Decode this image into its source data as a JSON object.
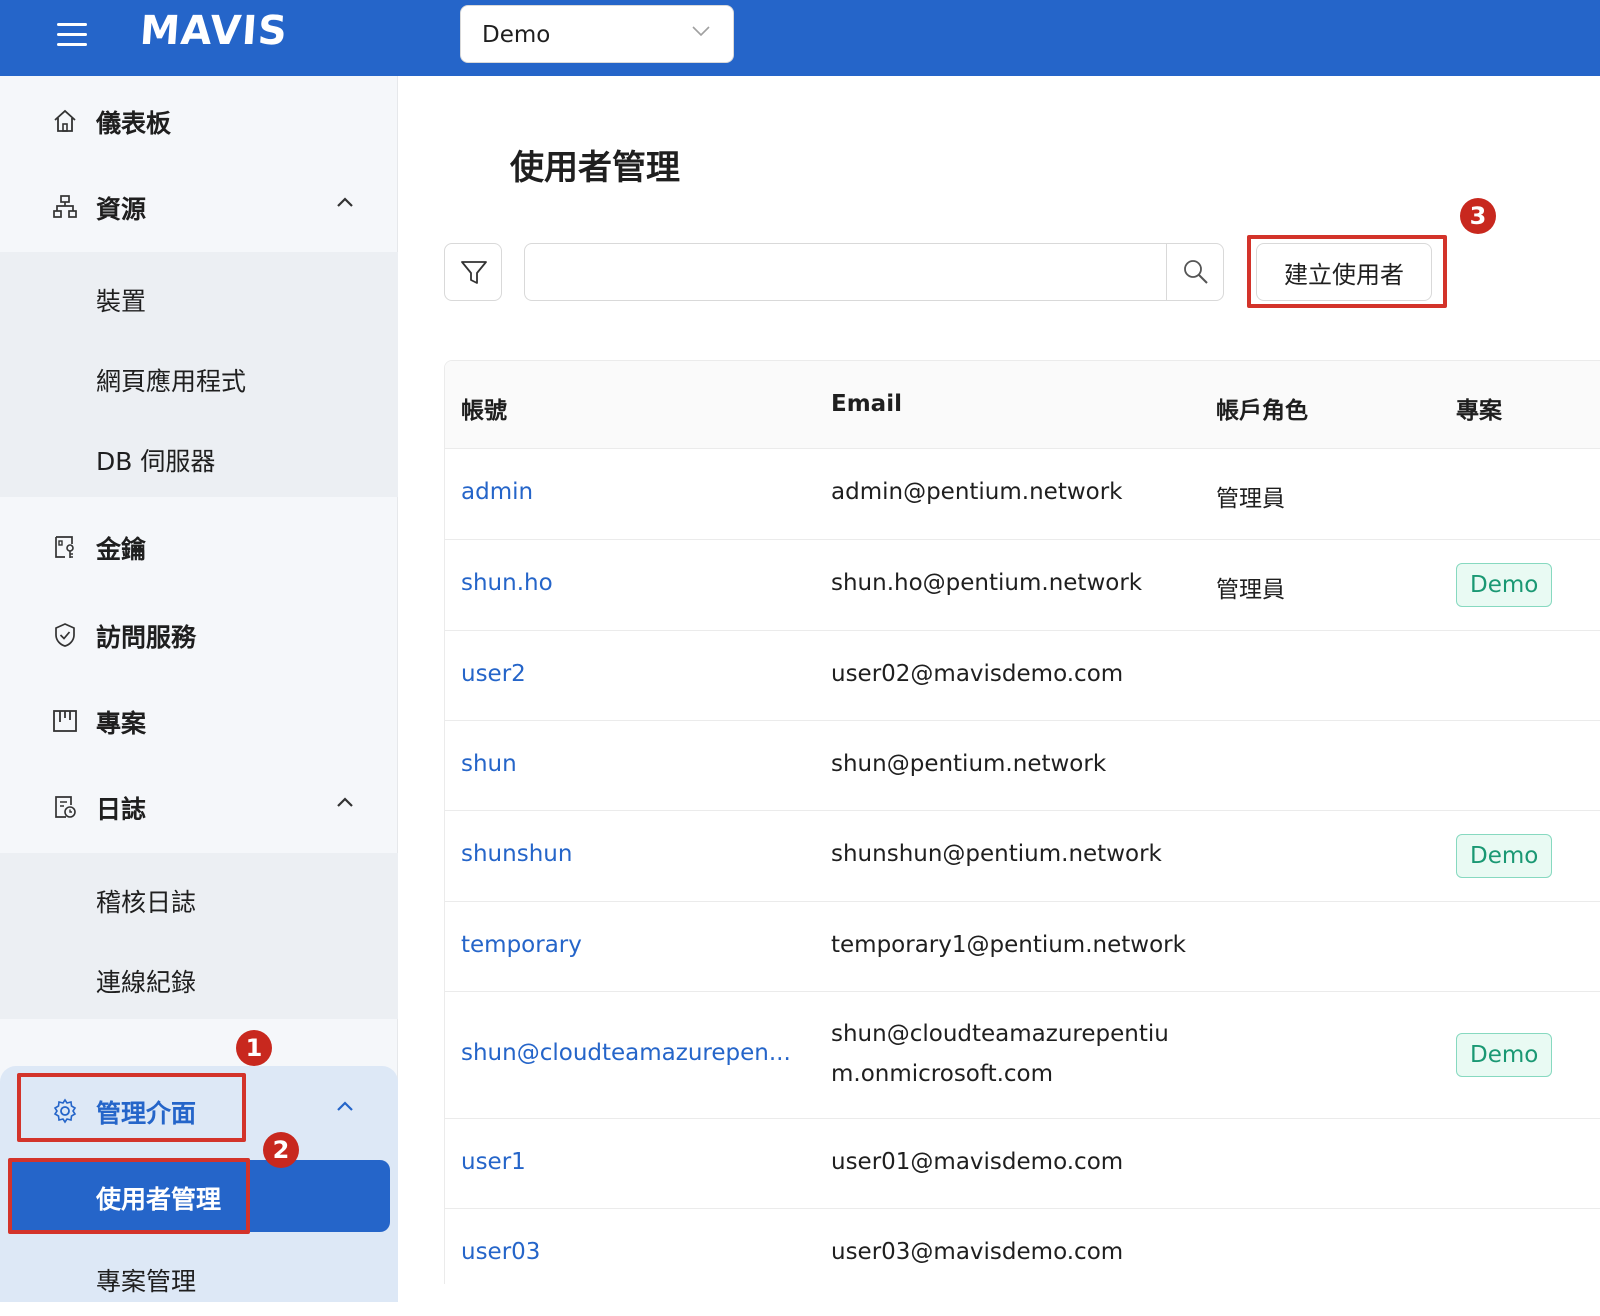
{
  "header": {
    "logo": "MAVIS",
    "project_select": "Demo"
  },
  "sidebar": {
    "dashboard": "儀表板",
    "resources": "資源",
    "resources_sub": [
      "裝置",
      "網頁應用程式",
      "DB 伺服器"
    ],
    "keys": "金鑰",
    "access_service": "訪問服務",
    "projects": "專案",
    "logs": "日誌",
    "logs_sub": [
      "稽核日誌",
      "連線紀錄"
    ],
    "admin": "管理介面",
    "admin_sub_active": "使用者管理",
    "admin_sub": [
      "專案管理"
    ]
  },
  "annotations": [
    "1",
    "2",
    "3"
  ],
  "main": {
    "title": "使用者管理",
    "search_placeholder": "",
    "create_button": "建立使用者"
  },
  "table": {
    "columns": [
      "帳號",
      "Email",
      "帳戶角色",
      "專案"
    ],
    "rows": [
      {
        "account": "admin",
        "email": "admin@pentium.network",
        "role": "管理員",
        "project": ""
      },
      {
        "account": "shun.ho",
        "email": "shun.ho@pentium.network",
        "role": "管理員",
        "project": "Demo"
      },
      {
        "account": "user2",
        "email": "user02@mavisdemo.com",
        "role": "",
        "project": ""
      },
      {
        "account": "shun",
        "email": "shun@pentium.network",
        "role": "",
        "project": ""
      },
      {
        "account": "shunshun",
        "email": "shunshun@pentium.network",
        "role": "",
        "project": "Demo"
      },
      {
        "account": "temporary",
        "email": "temporary1@pentium.network",
        "role": "",
        "project": ""
      },
      {
        "account": "shun@cloudteamazurepen...",
        "email": "shun@cloudteamazurepentiu",
        "email2": "m.onmicrosoft.com",
        "role": "",
        "project": "Demo"
      },
      {
        "account": "user1",
        "email": "user01@mavisdemo.com",
        "role": "",
        "project": ""
      },
      {
        "account": "user03",
        "email": "user03@mavisdemo.com",
        "role": "",
        "project": ""
      }
    ]
  },
  "colors": {
    "brand": "#2565c9",
    "annotation_red": "#d3332a",
    "tag_green": "#1a9873"
  }
}
